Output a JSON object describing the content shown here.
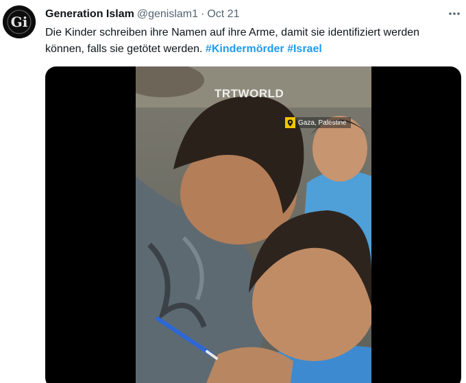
{
  "author": {
    "display_name": "Generation Islam",
    "handle": "@genislam1",
    "separator": "·",
    "timestamp": "Oct 21",
    "avatar_text": "Gi"
  },
  "tweet": {
    "text": "Die Kinder schreiben ihre Namen auf ihre Arme, damit sie identifiziert werden können, falls sie getötet werden. ",
    "hashtags": [
      "#Kindermörder",
      "#Israel"
    ],
    "hashtag_separator": " "
  },
  "media": {
    "watermark": "TRTWORLD",
    "location_label": "Gaza, Palestine"
  },
  "icons": {
    "more": "more-horizontal-icon",
    "location": "map-pin-icon"
  },
  "colors": {
    "text_primary": "#0f1419",
    "text_secondary": "#536471",
    "hashtag": "#1d9bf0",
    "media_background": "#000000",
    "location_pin": "#f5c400"
  }
}
